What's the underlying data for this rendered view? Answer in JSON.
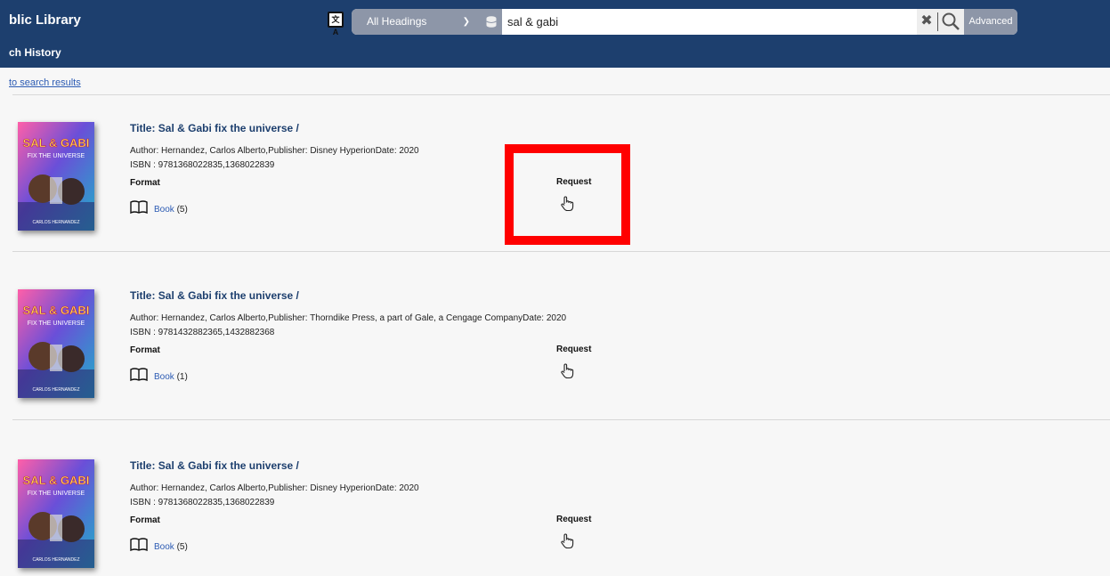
{
  "header": {
    "library_title": "blic Library",
    "search_history": "ch History",
    "search": {
      "scope": "All Headings",
      "query": "sal & gabi",
      "advanced": "Advanced"
    }
  },
  "nav": {
    "back_link": "to search results"
  },
  "records": [
    {
      "title": "Title: Sal & Gabi fix the universe /",
      "author": "Author: Hernandez, Carlos Alberto,Publisher: Disney HyperionDate: 2020",
      "isbn": "ISBN : 9781368022835,1368022839",
      "format_label": "Format",
      "format_link": "Book",
      "format_count": " (5)",
      "request_label": "Request"
    },
    {
      "title": "Title: Sal & Gabi fix the universe /",
      "author": "Author: Hernandez, Carlos Alberto,Publisher: Thorndike Press, a part of Gale, a Cengage CompanyDate: 2020",
      "isbn": "ISBN : 9781432882365,1432882368",
      "format_label": "Format",
      "format_link": "Book",
      "format_count": " (1)",
      "request_label": "Request"
    },
    {
      "title": "Title: Sal & Gabi fix the universe /",
      "author": "Author: Hernandez, Carlos Alberto,Publisher: Disney HyperionDate: 2020",
      "isbn": "ISBN : 9781368022835,1368022839",
      "format_label": "Format",
      "format_link": "Book",
      "format_count": " (5)",
      "request_label": "Request"
    }
  ],
  "cover_art": {
    "title_text": "SAL & GABI",
    "subtitle_text": "FIX THE UNIVERSE",
    "author_text": "CARLOS HERNANDEZ"
  },
  "colors": {
    "header_bg": "#1d3f6e",
    "link": "#2c5bb3",
    "highlight": "#ff0000"
  },
  "icons": [
    "language-icon",
    "database-icon",
    "clear-icon",
    "search-icon",
    "book-icon",
    "hand-pointer-icon"
  ]
}
